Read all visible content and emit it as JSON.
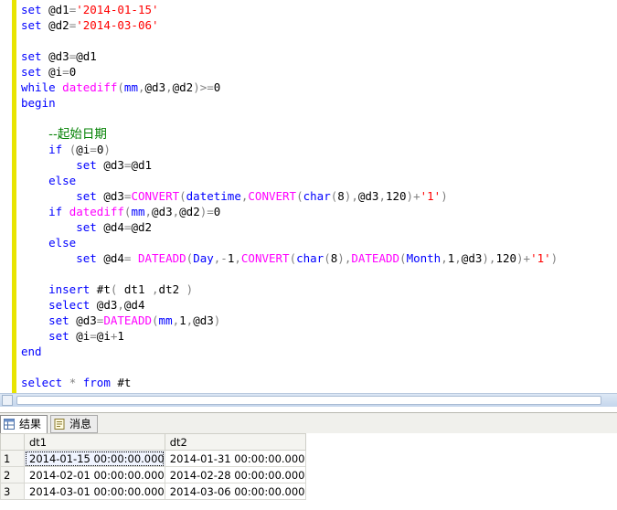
{
  "editor": {
    "lines": [
      "set @d1='2014-01-15'",
      "set @d2='2014-03-06'",
      "",
      "set @d3=@d1",
      "set @i=0",
      "while datediff(mm,@d3,@d2)>=0",
      "begin",
      "",
      "    --起始日期",
      "    if (@i=0)",
      "        set @d3=@d1",
      "    else",
      "        set @d3=CONVERT(datetime,CONVERT(char(8),@d3,120)+'1')",
      "    if datediff(mm,@d3,@d2)=0",
      "        set @d4=@d2",
      "    else",
      "        set @d4= DATEADD(Day,-1,CONVERT(char(8),DATEADD(Month,1,@d3),120)+'1')",
      "",
      "    insert #t( dt1 ,dt2 )",
      "    select @d3,@d4",
      "    set @d3=DATEADD(mm,1,@d3)",
      "    set @i=@i+1",
      "end",
      "",
      "select * from #t"
    ]
  },
  "tabs": {
    "results_label": "结果",
    "messages_label": "消息",
    "results_icon": "grid-icon",
    "messages_icon": "message-icon"
  },
  "results": {
    "columns": [
      "dt1",
      "dt2"
    ],
    "rows": [
      {
        "num": "1",
        "dt1": "2014-01-15 00:00:00.000",
        "dt2": "2014-01-31 00:00:00.000"
      },
      {
        "num": "2",
        "dt1": "2014-02-01 00:00:00.000",
        "dt2": "2014-02-28 00:00:00.000"
      },
      {
        "num": "3",
        "dt1": "2014-03-01 00:00:00.000",
        "dt2": "2014-03-06 00:00:00.000"
      }
    ]
  },
  "colors": {
    "keyword": "#0000ff",
    "function": "#ff00ff",
    "string": "#ff0000",
    "comment": "#008000",
    "operator": "#808080",
    "change_bar": "#e8e400"
  }
}
